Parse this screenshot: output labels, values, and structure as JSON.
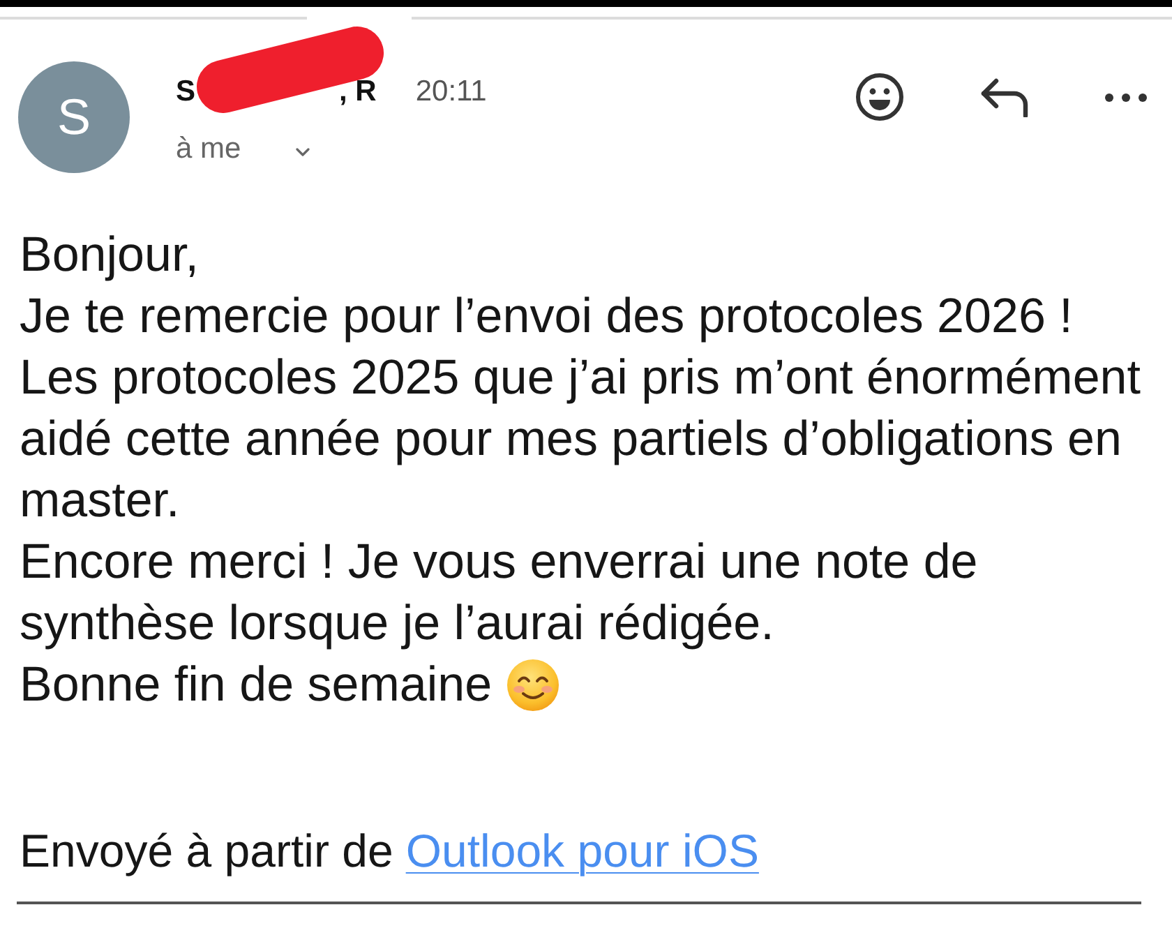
{
  "message_header": {
    "avatar_initial": "S",
    "sender_name_start": "S",
    "sender_name_end": ", R",
    "redacted": true,
    "time": "20:11",
    "recipient": "à me"
  },
  "body": {
    "paragraphs": [
      "Bonjour,",
      "Je te remercie pour l’envoi des protocoles 2026 !",
      "Les protocoles 2025 que j’ai pris m’ont énormément aidé cette année pour mes partiels d’obligations en master.",
      "Encore merci ! Je vous enverrai une note de synthèse lorsque je l’aurai rédigée."
    ],
    "closing": "Bonne fin de semaine"
  },
  "signature": {
    "text": "Envoyé à partir de",
    "link": "Outlook pour iOS"
  }
}
